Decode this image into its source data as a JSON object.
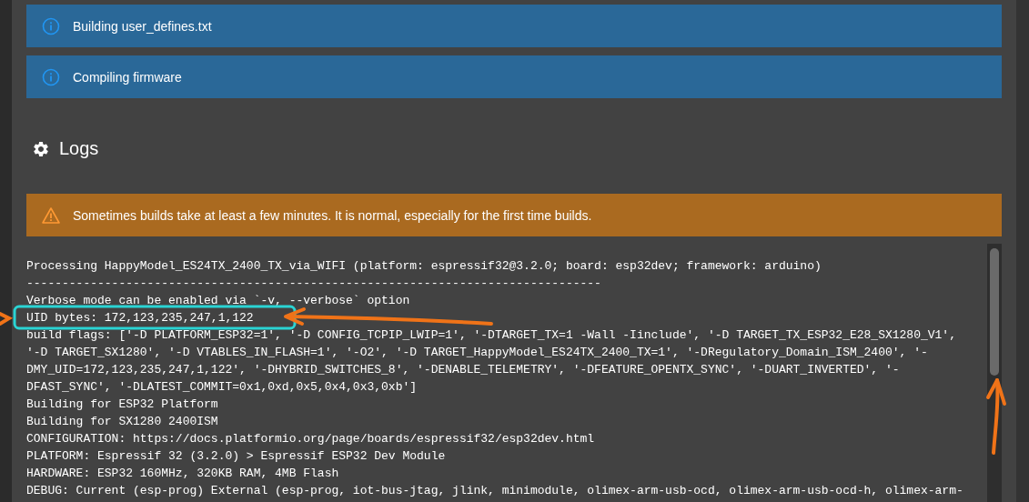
{
  "alerts": [
    {
      "kind": "info",
      "text": "Building user_defines.txt"
    },
    {
      "kind": "info",
      "text": "Compiling firmware"
    }
  ],
  "logs": {
    "title": "Logs",
    "alerts": [
      {
        "kind": "warning",
        "text": "Sometimes builds take at least a few minutes. It is normal, especially for the first time builds."
      }
    ],
    "lines": [
      "Processing HappyModel_ES24TX_2400_TX_via_WIFI (platform: espressif32@3.2.0; board: esp32dev; framework: arduino)",
      "---------------------------------------------------------------------------------",
      "Verbose mode can be enabled via `-v, --verbose` option",
      "UID bytes: 172,123,235,247,1,122",
      "build flags: ['-D PLATFORM_ESP32=1', '-D CONFIG_TCPIP_LWIP=1', '-DTARGET_TX=1 -Wall -Iinclude', '-D TARGET_TX_ESP32_E28_SX1280_V1',",
      "'-D TARGET_SX1280', '-D VTABLES_IN_FLASH=1', '-O2', '-D TARGET_HappyModel_ES24TX_2400_TX=1', '-DRegulatory_Domain_ISM_2400', '-",
      "DMY_UID=172,123,235,247,1,122', '-DHYBRID_SWITCHES_8', '-DENABLE_TELEMETRY', '-DFEATURE_OPENTX_SYNC', '-DUART_INVERTED', '-",
      "DFAST_SYNC', '-DLATEST_COMMIT=0x1,0xd,0x5,0x4,0x3,0xb']",
      "Building for ESP32 Platform",
      "Building for SX1280 2400ISM",
      "CONFIGURATION: https://docs.platformio.org/page/boards/espressif32/esp32dev.html",
      "PLATFORM: Espressif 32 (3.2.0) > Espressif ESP32 Dev Module",
      "HARDWARE: ESP32 160MHz, 320KB RAM, 4MB Flash",
      "DEBUG: Current (esp-prog) External (esp-prog, iot-bus-jtag, jlink, minimodule, olimex-arm-usb-ocd, olimex-arm-usb-ocd-h, olimex-arm-"
    ]
  }
}
